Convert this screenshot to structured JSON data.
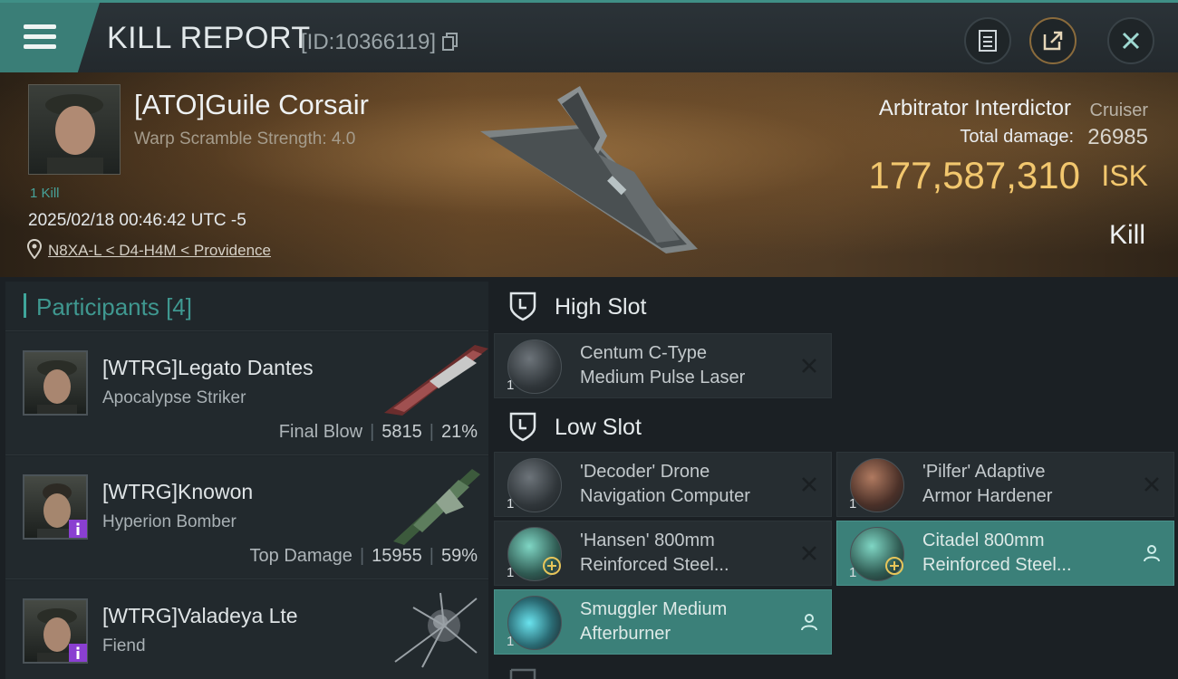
{
  "header": {
    "title": "KILL REPORT",
    "report_id": "[ID:10366119]",
    "buttons": [
      "notes-icon",
      "share-icon",
      "close-icon"
    ]
  },
  "victim": {
    "name": "[ATO]Guile Corsair",
    "warp_scramble": "Warp Scramble Strength: 4.0",
    "kills": "1 Kill",
    "timestamp": "2025/02/18 00:46:42 UTC -5",
    "location": "N8XA-L < D4-H4M < Providence",
    "ship_name": "Arbitrator Interdictor",
    "ship_class": "Cruiser",
    "total_damage_label": "Total damage:",
    "total_damage": "26985",
    "isk_value": "177,587,310",
    "isk_label": "ISK",
    "outcome": "Kill"
  },
  "participants": {
    "title": "Participants [4]",
    "items": [
      {
        "name": "[WTRG]Legato Dantes",
        "ship": "Apocalypse Striker",
        "label": "Final Blow",
        "damage": "5815",
        "percent": "21%",
        "badge": false
      },
      {
        "name": "[WTRG]Knowon",
        "ship": "Hyperion Bomber",
        "label": "Top Damage",
        "damage": "15955",
        "percent": "59%",
        "badge": true
      },
      {
        "name": "[WTRG]Valadeya Lte",
        "ship": "Fiend",
        "label": "",
        "damage": "",
        "percent": "",
        "badge": true
      }
    ]
  },
  "fitting": {
    "high_slot": {
      "title": "High Slot",
      "modules": [
        {
          "line1": "Centum C-Type",
          "line2": "Medium Pulse Laser",
          "qty": "1",
          "status": "destroyed"
        }
      ]
    },
    "low_slot": {
      "title": "Low Slot",
      "modules": [
        {
          "line1": "'Decoder' Drone",
          "line2": "Navigation Computer",
          "qty": "1",
          "status": "destroyed"
        },
        {
          "line1": "'Pilfer' Adaptive",
          "line2": "Armor Hardener",
          "qty": "1",
          "status": "destroyed"
        },
        {
          "line1": "'Hansen' 800mm",
          "line2": "Reinforced Steel...",
          "qty": "1",
          "status": "destroyed"
        },
        {
          "line1": "Citadel 800mm",
          "line2": "Reinforced Steel...",
          "qty": "1",
          "status": "dropped"
        },
        {
          "line1": "Smuggler Medium",
          "line2": "Afterburner",
          "qty": "1",
          "status": "dropped"
        }
      ]
    }
  },
  "colors": {
    "accent": "#3fa69b",
    "isk": "#f2c76e",
    "highlight": "#3b8079"
  }
}
